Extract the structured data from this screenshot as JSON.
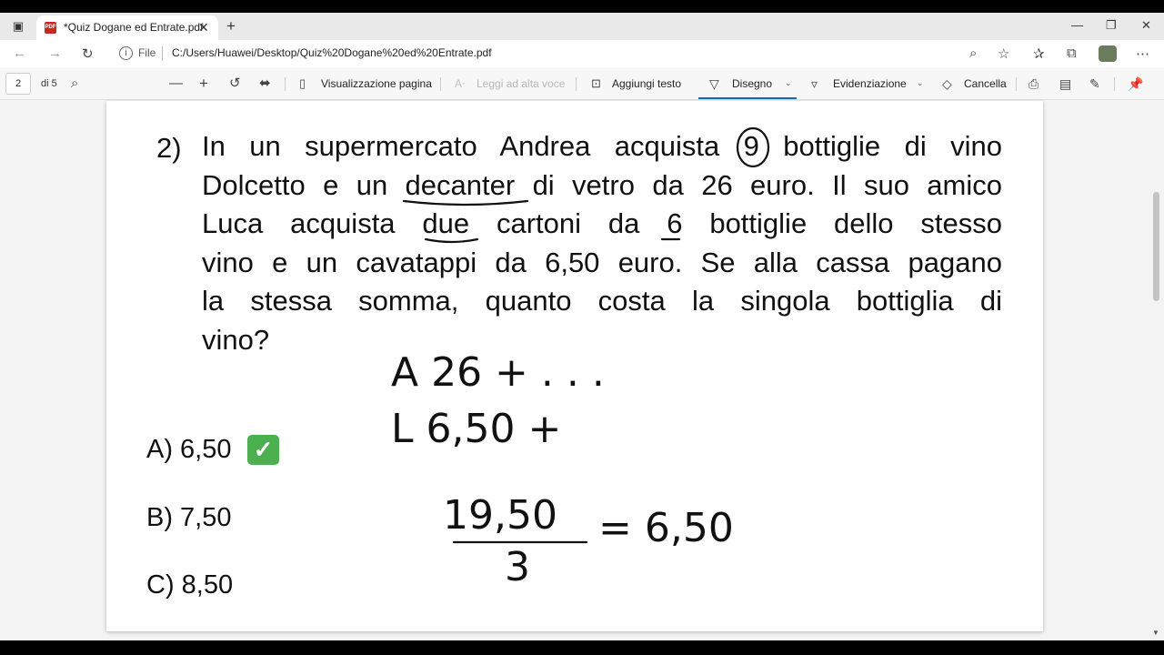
{
  "browser": {
    "tab_title": "*Quiz Dogane ed Entrate.pdf",
    "file_label": "File",
    "url": "C:/Users/Huawei/Desktop/Quiz%20Dogane%20ed%20Entrate.pdf"
  },
  "toolbar": {
    "page_current": "2",
    "page_count": "di 5",
    "view_label": "Visualizzazione pagina",
    "read_aloud_label": "Leggi ad alta voce",
    "add_text_label": "Aggiungi testo",
    "draw_label": "Disegno",
    "highlight_label": "Evidenziazione",
    "erase_label": "Cancella",
    "accent_color": "#0f6cbd"
  },
  "document": {
    "question_number": "2)",
    "question_lines": [
      "In un supermercato Andrea acquista 9 bottiglie di vino",
      "Dolcetto e un decanter di vetro da 26 euro. Il suo amico",
      "Luca acquista due cartoni da 6 bottiglie dello stesso",
      "vino e un cavatappi da 6,50 euro. Se alla cassa pagano",
      "la stessa somma, quanto costa la singola bottiglia di",
      "vino?"
    ],
    "answers": [
      "A) 6,50",
      "B) 7,50",
      "C) 8,50"
    ],
    "check_mark": "✓",
    "check_color": "#4caf50"
  },
  "handwriting": {
    "line_a": "A  26 + . . .",
    "line_l": "L  6,50 +",
    "fraction_numerator": "19,50",
    "fraction_denominator": "3",
    "fraction_result": "= 6,50"
  }
}
